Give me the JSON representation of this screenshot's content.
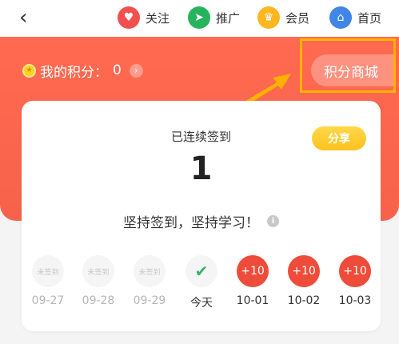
{
  "nav": {
    "back_glyph": "‹",
    "items": [
      {
        "label": "关注",
        "icon": "heart-icon",
        "glyph": "♥",
        "color": "#f24f4f"
      },
      {
        "label": "推广",
        "icon": "send-icon",
        "glyph": "➤",
        "color": "#27b35d"
      },
      {
        "label": "会员",
        "icon": "crown-icon",
        "glyph": "♛",
        "color": "#ffb61f"
      },
      {
        "label": "首页",
        "icon": "home-icon",
        "glyph": "⌂",
        "color": "#3f86e8"
      }
    ]
  },
  "points": {
    "label": "我的积分：",
    "value": "0",
    "chevron": "›",
    "coin_glyph": "★"
  },
  "mall": {
    "label": "积分商城"
  },
  "card": {
    "streak_label": "已连续签到",
    "streak_count": "1",
    "share_label": "分享",
    "motto": "坚持签到，坚持学习！",
    "info_glyph": "i"
  },
  "days": [
    {
      "badge": "未签到",
      "date": "09-27",
      "state": "missed"
    },
    {
      "badge": "未签到",
      "date": "09-28",
      "state": "missed"
    },
    {
      "badge": "未签到",
      "date": "09-29",
      "state": "missed"
    },
    {
      "badge": "✔",
      "date": "今天",
      "state": "today"
    },
    {
      "badge": "+10",
      "date": "10-01",
      "state": "future"
    },
    {
      "badge": "+10",
      "date": "10-02",
      "state": "future"
    },
    {
      "badge": "+10",
      "date": "10-03",
      "state": "future"
    }
  ],
  "colors": {
    "banner": "#f7624c",
    "highlight": "#ffb400",
    "reward": "#ee4b3a",
    "check": "#33b56a"
  }
}
